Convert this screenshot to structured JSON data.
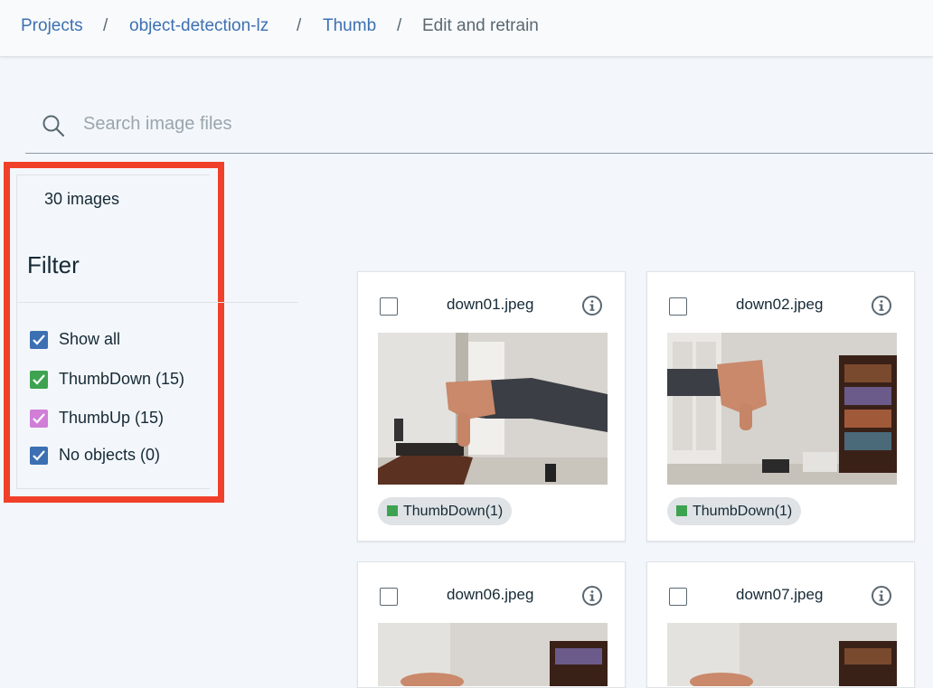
{
  "breadcrumb": {
    "items": [
      "Projects",
      "object-detection-lz",
      "Thumb"
    ],
    "separator": "/",
    "current": "Edit and retrain"
  },
  "search": {
    "placeholder": "Search image files",
    "value": "",
    "icon": "search-icon"
  },
  "sidebar": {
    "count_label": "30 images",
    "filter_title": "Filter",
    "filters": [
      {
        "label": "Show all",
        "checked": true,
        "color": "#3d70b2"
      },
      {
        "label": "ThumbDown (15)",
        "checked": true,
        "color": "#3ea351"
      },
      {
        "label": "ThumbUp (15)",
        "checked": true,
        "color": "#d07ed8"
      },
      {
        "label": "No objects (0)",
        "checked": true,
        "color": "#3d70b2"
      }
    ]
  },
  "images": [
    {
      "filename": "down01.jpeg",
      "tag": "ThumbDown(1)",
      "tag_color": "#3ea351"
    },
    {
      "filename": "down02.jpeg",
      "tag": "ThumbDown(1)",
      "tag_color": "#3ea351"
    },
    {
      "filename": "down06.jpeg"
    },
    {
      "filename": "down07.jpeg"
    }
  ],
  "colors": {
    "highlight": "#f1402a",
    "link": "#3d70b2",
    "page_bg": "#f3f7fb"
  }
}
